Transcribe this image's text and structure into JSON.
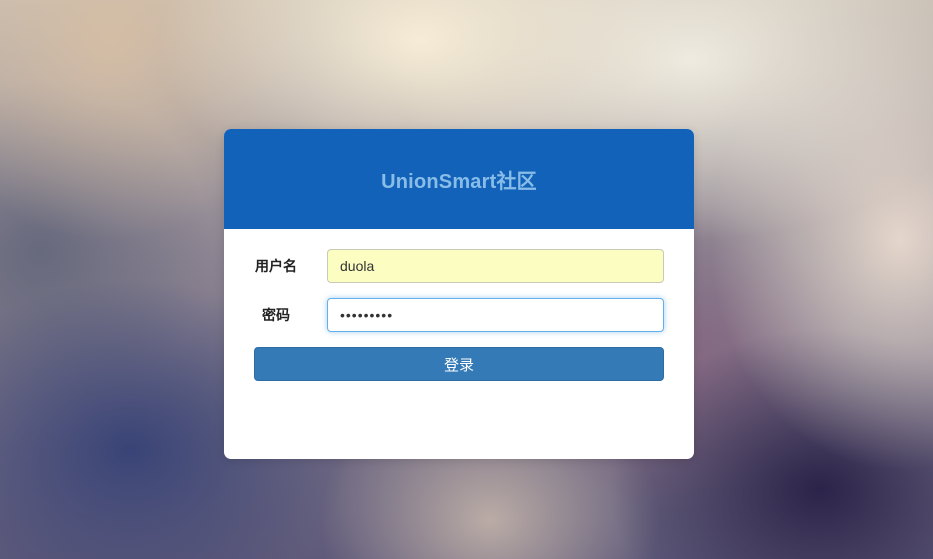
{
  "login": {
    "title": "UnionSmart社区",
    "username_label": "用户名",
    "username_value": "duola",
    "password_label": "密码",
    "password_value": "•••••••••",
    "submit_label": "登录"
  },
  "colors": {
    "header": "#1162b8",
    "title": "#89bde8",
    "button": "#337ab7",
    "autofill": "#fbfdc1",
    "focus": "#66afe9"
  }
}
